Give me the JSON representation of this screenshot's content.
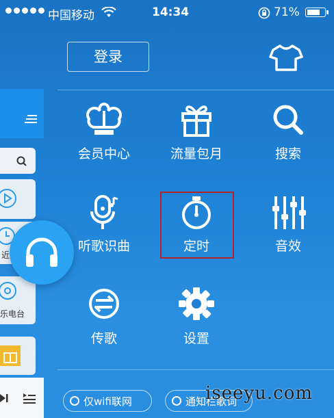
{
  "status_bar": {
    "carrier": "中国移动",
    "time": "14:34",
    "battery": "71%"
  },
  "header": {
    "login_label": "登录"
  },
  "menu": {
    "items": [
      {
        "label": "会员中心",
        "icon": "crown-icon"
      },
      {
        "label": "流量包月",
        "icon": "gift-icon"
      },
      {
        "label": "搜索",
        "icon": "search-icon"
      },
      {
        "label": "听歌识曲",
        "icon": "music-recognition-icon"
      },
      {
        "label": "定时",
        "icon": "timer-icon",
        "highlighted": true
      },
      {
        "label": "音效",
        "icon": "equalizer-icon"
      },
      {
        "label": "传歌",
        "icon": "transfer-icon"
      },
      {
        "label": "设置",
        "icon": "gear-icon"
      }
    ]
  },
  "left_panel": {
    "label_recent": "近",
    "label_radio": "乐电台"
  },
  "toggles": {
    "wifi_only": "仅wifi联网",
    "notification_lyrics": "通知栏歌词"
  },
  "watermark": "iseeyu.com",
  "colors": {
    "background": "#1e82d6",
    "highlight_border": "#b0242a",
    "headphone_button": "#2aa3f2"
  }
}
